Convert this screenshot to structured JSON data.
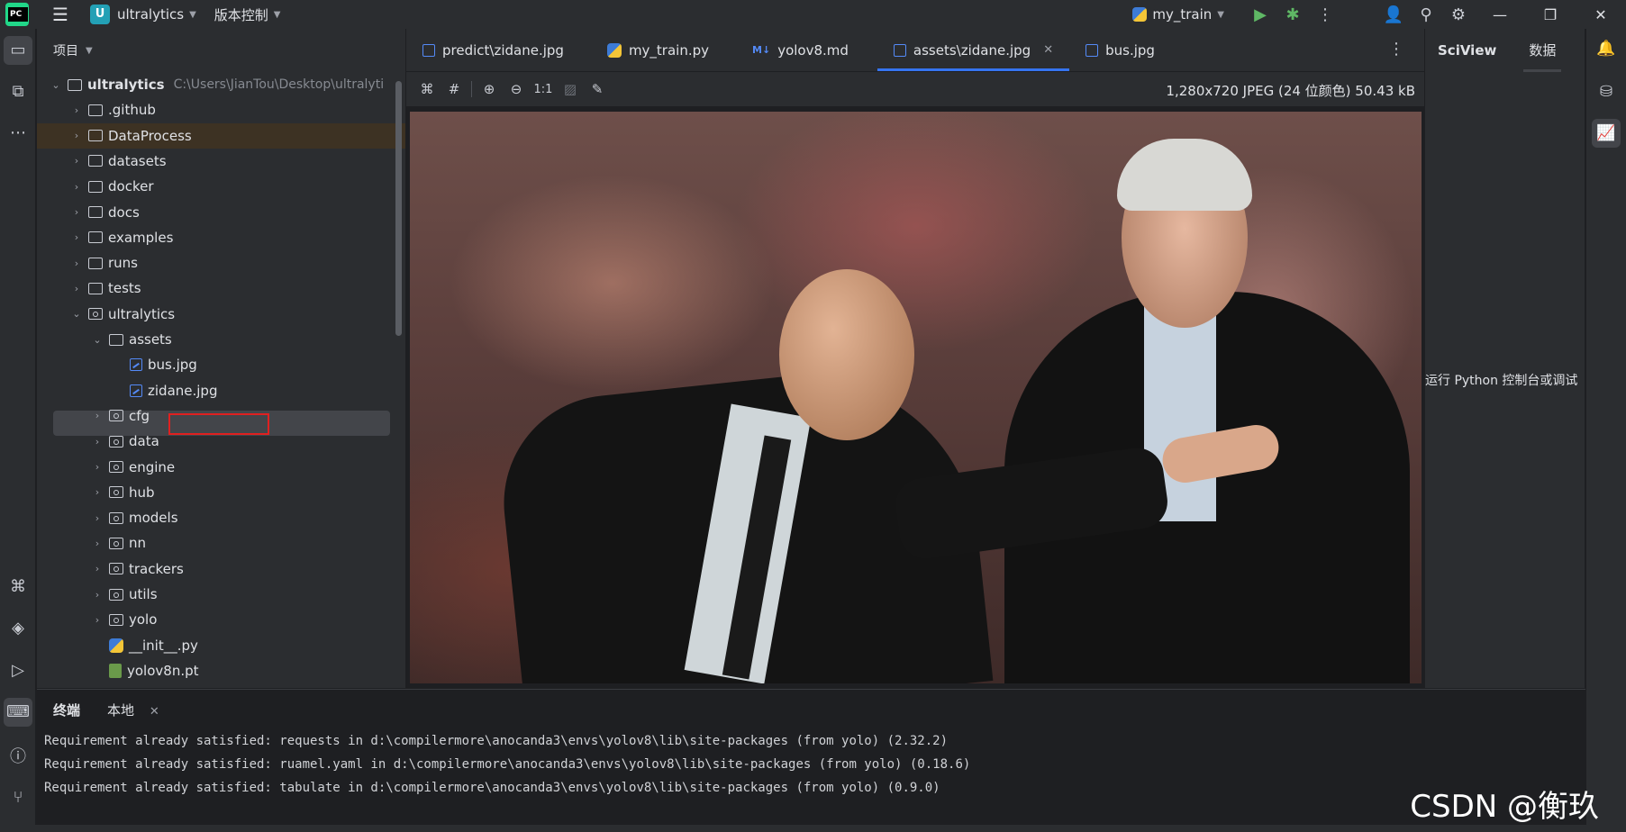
{
  "titlebar": {
    "project_badge": "U",
    "project_name": "ultralytics",
    "vcs_label": "版本控制",
    "run_config": "my_train"
  },
  "project_panel": {
    "title": "项目",
    "tree": [
      {
        "label": "ultralytics",
        "path": "C:\\Users\\JianTou\\Desktop\\ultralyti",
        "type": "root"
      },
      {
        "label": ".github",
        "type": "folder"
      },
      {
        "label": "DataProcess",
        "type": "folder"
      },
      {
        "label": "datasets",
        "type": "folder"
      },
      {
        "label": "docker",
        "type": "folder"
      },
      {
        "label": "docs",
        "type": "folder"
      },
      {
        "label": "examples",
        "type": "folder"
      },
      {
        "label": "runs",
        "type": "folder"
      },
      {
        "label": "tests",
        "type": "folder"
      },
      {
        "label": "ultralytics",
        "type": "package"
      },
      {
        "label": "assets",
        "type": "folder"
      },
      {
        "label": "bus.jpg",
        "type": "image"
      },
      {
        "label": "zidane.jpg",
        "type": "image"
      },
      {
        "label": "cfg",
        "type": "package"
      },
      {
        "label": "data",
        "type": "package"
      },
      {
        "label": "engine",
        "type": "package"
      },
      {
        "label": "hub",
        "type": "package"
      },
      {
        "label": "models",
        "type": "package"
      },
      {
        "label": "nn",
        "type": "package"
      },
      {
        "label": "trackers",
        "type": "package"
      },
      {
        "label": "utils",
        "type": "package"
      },
      {
        "label": "yolo",
        "type": "package"
      },
      {
        "label": "__init__.py",
        "type": "python"
      },
      {
        "label": "yolov8n.pt",
        "type": "file"
      }
    ]
  },
  "editor": {
    "tabs": [
      {
        "label": "predict\\zidane.jpg",
        "icon": "image-file-icon"
      },
      {
        "label": "my_train.py",
        "icon": "python-file-icon"
      },
      {
        "label": "yolov8.md",
        "icon": "markdown-file-icon",
        "badge": "M↓"
      },
      {
        "label": "assets\\zidane.jpg",
        "icon": "image-file-icon",
        "active": true
      },
      {
        "label": "bus.jpg",
        "icon": "image-file-icon"
      }
    ],
    "zoom_reset_label": "1:1",
    "image_info": "1,280x720 JPEG (24 位颜色) 50.43 kB"
  },
  "right_panel": {
    "tabs": [
      "SciView",
      "数据"
    ],
    "message": "运行 Python 控制台或调试"
  },
  "terminal": {
    "tabs": [
      "终端",
      "本地"
    ],
    "lines": [
      "Requirement already satisfied: requests in d:\\compilermore\\anocanda3\\envs\\yolov8\\lib\\site-packages (from yolo) (2.32.2)",
      "Requirement already satisfied: ruamel.yaml in d:\\compilermore\\anocanda3\\envs\\yolov8\\lib\\site-packages (from yolo) (0.18.6)",
      "Requirement already satisfied: tabulate in d:\\compilermore\\anocanda3\\envs\\yolov8\\lib\\site-packages (from yolo) (0.9.0)"
    ]
  },
  "watermark": "CSDN @衡玖",
  "colors": {
    "accent": "#3574f0",
    "highlight_box": "#e02020",
    "bg_panel": "#2b2d30",
    "bg_editor": "#1e1f22"
  }
}
